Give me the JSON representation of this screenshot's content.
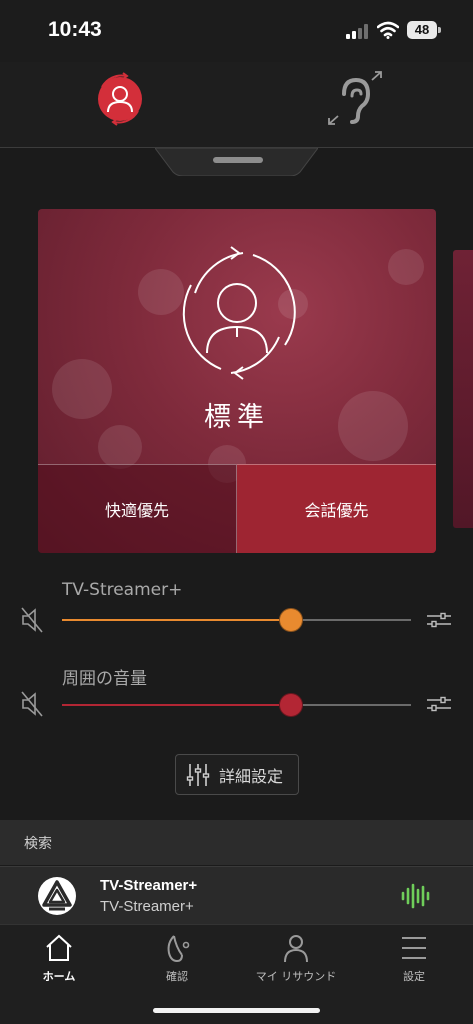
{
  "status_bar": {
    "time": "10:43",
    "battery": "48",
    "icons": [
      "signal-icon",
      "wifi-icon",
      "battery-icon"
    ]
  },
  "header": {
    "icons": [
      "program-profile-icon",
      "hearing-aid-ear-icon"
    ],
    "accent_color": "#d32f3a"
  },
  "program_card": {
    "title": "標準",
    "icon": "user-cycle-icon",
    "modes": {
      "comfort": "快適優先",
      "speech": "会話優先"
    },
    "selected_mode": "speech"
  },
  "sliders": {
    "streamer": {
      "label": "TV-Streamer+",
      "level": 0.655,
      "color": "#e98a2f"
    },
    "ambient": {
      "label": "周囲の音量",
      "level": 0.655,
      "color": "#b32634"
    }
  },
  "detail_button": {
    "label": "詳細設定",
    "icon": "equalizer-icon"
  },
  "search": {
    "label": "検索"
  },
  "device": {
    "name": "TV-Streamer+",
    "subtitle": "TV-Streamer+",
    "icon": "streamer-logo-icon",
    "status_icon": "audio-wave-icon",
    "status_color": "#6fce5a"
  },
  "bottom_nav": {
    "items": [
      {
        "label": "ホーム",
        "icon": "home-icon",
        "active": true
      },
      {
        "label": "確認",
        "icon": "hearing-aid-icon",
        "active": false
      },
      {
        "label": "マイ リサウンド",
        "icon": "person-icon",
        "active": false
      },
      {
        "label": "設定",
        "icon": "menu-icon",
        "active": false
      }
    ]
  }
}
